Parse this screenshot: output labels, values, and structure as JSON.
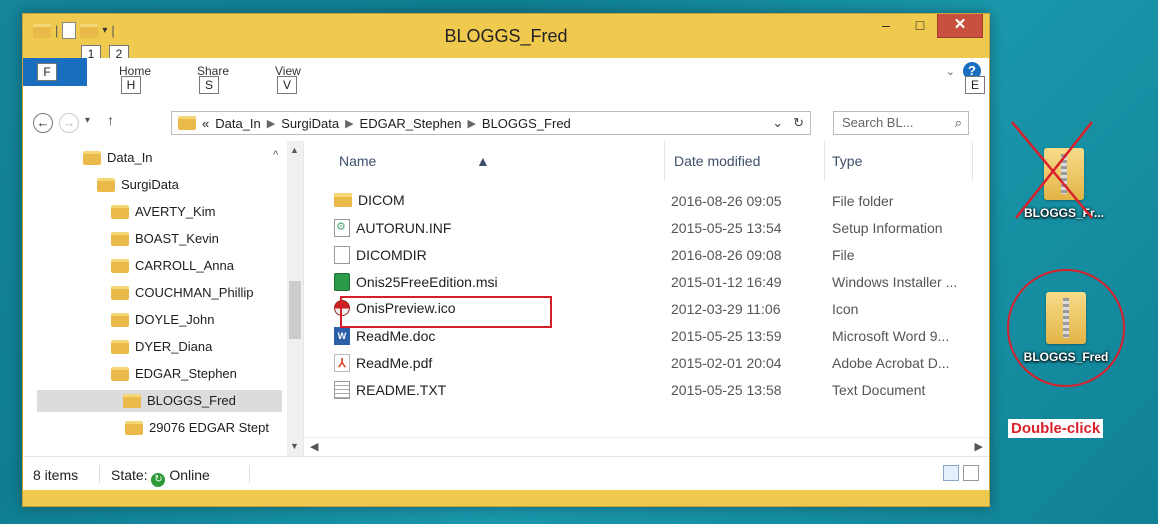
{
  "window": {
    "title": "BLOGGS_Fred",
    "qat_keytips": [
      "1",
      "2"
    ],
    "buttons": {
      "minimize": "–",
      "maximize": "□",
      "close": "✕"
    }
  },
  "ribbon": {
    "file_keytip": "F",
    "tabs": [
      {
        "label": "Home",
        "keytip": "H"
      },
      {
        "label": "Share",
        "keytip": "S"
      },
      {
        "label": "View",
        "keytip": "V"
      }
    ],
    "help_keytip": "E"
  },
  "address": {
    "overflow": "«",
    "crumbs": [
      "Data_In",
      "SurgiData",
      "EDGAR_Stephen",
      "BLOGGS_Fred"
    ],
    "search_placeholder": "Search BL..."
  },
  "nav_tree": [
    {
      "label": "Data_In",
      "level": 0,
      "selected": false
    },
    {
      "label": "SurgiData",
      "level": 1,
      "selected": false
    },
    {
      "label": "AVERTY_Kim",
      "level": 2,
      "selected": false
    },
    {
      "label": "BOAST_Kevin",
      "level": 2,
      "selected": false
    },
    {
      "label": "CARROLL_Anna",
      "level": 2,
      "selected": false
    },
    {
      "label": "COUCHMAN_Phillip",
      "level": 2,
      "selected": false
    },
    {
      "label": "DOYLE_John",
      "level": 2,
      "selected": false
    },
    {
      "label": "DYER_Diana",
      "level": 2,
      "selected": false
    },
    {
      "label": "EDGAR_Stephen",
      "level": 2,
      "selected": false
    },
    {
      "label": "BLOGGS_Fred",
      "level": 3,
      "selected": true
    },
    {
      "label": "29076 EDGAR Stept",
      "level": 3,
      "selected": false
    }
  ],
  "columns": {
    "name": "Name",
    "date": "Date modified",
    "type": "Type"
  },
  "files": [
    {
      "name": "DICOM",
      "date": "2016-08-26 09:05",
      "type": "File folder",
      "icon": "folder-icon"
    },
    {
      "name": "AUTORUN.INF",
      "date": "2015-05-25 13:54",
      "type": "Setup Information",
      "icon": "inf-file-icon"
    },
    {
      "name": "DICOMDIR",
      "date": "2016-08-26 09:08",
      "type": "File",
      "icon": "file-icon"
    },
    {
      "name": "Onis25FreeEdition.msi",
      "date": "2015-01-12 16:49",
      "type": "Windows Installer ...",
      "icon": "msi-installer-icon"
    },
    {
      "name": "OnisPreview.ico",
      "date": "2012-03-29 11:06",
      "type": "Icon",
      "icon": "ico-file-icon"
    },
    {
      "name": "ReadMe.doc",
      "date": "2015-05-25 13:59",
      "type": "Microsoft Word 9...",
      "icon": "word-doc-icon"
    },
    {
      "name": "ReadMe.pdf",
      "date": "2015-02-01 20:04",
      "type": "Adobe Acrobat D...",
      "icon": "pdf-file-icon"
    },
    {
      "name": "README.TXT",
      "date": "2015-05-25 13:58",
      "type": "Text Document",
      "icon": "text-file-icon"
    }
  ],
  "status": {
    "items": "8 items",
    "state_label": "State:",
    "state_value": "Online"
  },
  "desktop": {
    "crossed_icon_label": "BLOGGS_Fr...",
    "circled_icon_label": "BLOGGS_Fred",
    "annotation": "Double-click"
  },
  "colors": {
    "highlight": "#d41f2a",
    "window_frame": "#f0c94f",
    "ribbon_file": "#1a6ebf"
  }
}
